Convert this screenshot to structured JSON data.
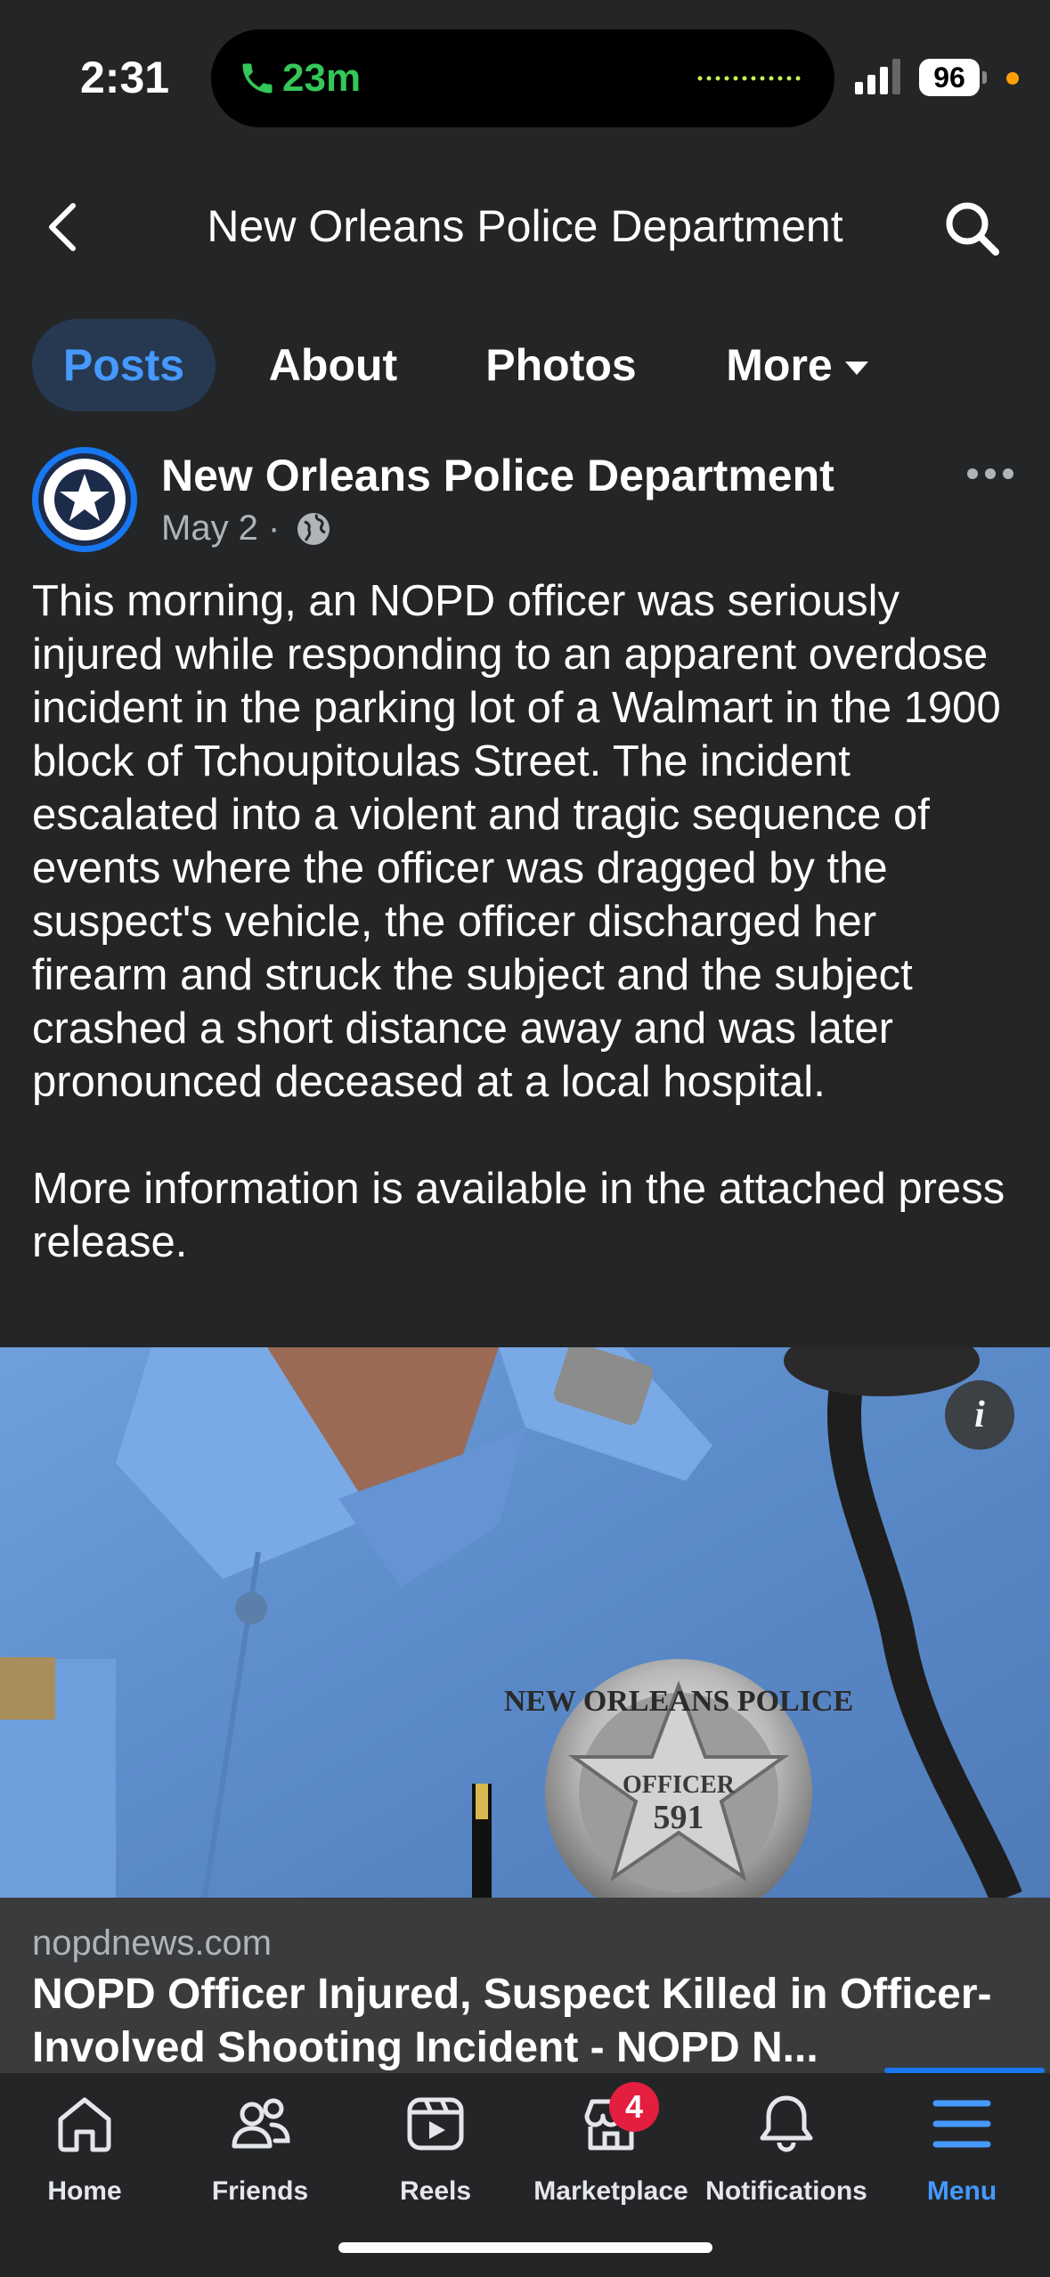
{
  "status_bar": {
    "time": "2:31",
    "call_duration": "23m",
    "battery": "96"
  },
  "header": {
    "title": "New Orleans Police Department"
  },
  "tabs": [
    {
      "label": "Posts",
      "active": true
    },
    {
      "label": "About"
    },
    {
      "label": "Photos"
    },
    {
      "label": "More"
    }
  ],
  "post": {
    "author": "New Orleans Police Department",
    "date": "May 2 ·",
    "paragraphs": [
      "This morning, an NOPD officer was seriously injured while responding to an apparent overdose incident in the parking lot of a Walmart in the 1900 block of Tchoupitoulas Street. The incident escalated into a violent and tragic sequence of events where the officer was dragged by the suspect's vehicle, the officer discharged her firearm and struck the subject and the subject crashed a short distance away and was later pronounced deceased at a local hospital.",
      "More information is available in the attached press release."
    ],
    "image_badge_text": {
      "top": "NEW ORLEANS POLICE",
      "middle": "OFFICER",
      "number": "591"
    }
  },
  "link_preview": {
    "domain": "nopdnews.com",
    "title": "NOPD Officer Injured, Suspect Killed in Officer-Involved Shooting Incident - NOPD N..."
  },
  "bottom_nav": [
    {
      "label": "Home",
      "icon": "home-icon"
    },
    {
      "label": "Friends",
      "icon": "friends-icon"
    },
    {
      "label": "Reels",
      "icon": "reels-icon"
    },
    {
      "label": "Marketplace",
      "icon": "marketplace-icon",
      "badge": "4"
    },
    {
      "label": "Notifications",
      "icon": "bell-icon"
    },
    {
      "label": "Menu",
      "icon": "menu-icon",
      "active": true
    }
  ],
  "colors": {
    "background": "#242526",
    "accent": "#4599ff",
    "badge": "#e41e3f",
    "call_green": "#34c759"
  }
}
